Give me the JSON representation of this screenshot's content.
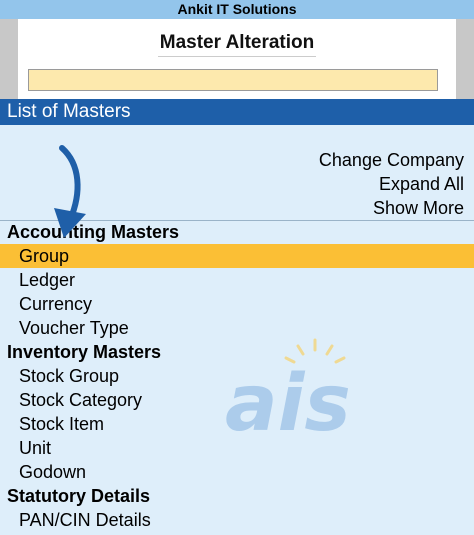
{
  "window": {
    "title": "Ankit IT Solutions"
  },
  "panel": {
    "title": "Master Alteration",
    "search_value": ""
  },
  "list": {
    "header": "List of Masters",
    "actions": [
      "Change Company",
      "Expand All",
      "Show More"
    ],
    "sections": [
      {
        "label": "Accounting Masters",
        "items": [
          "Group",
          "Ledger",
          "Currency",
          "Voucher Type"
        ]
      },
      {
        "label": "Inventory Masters",
        "items": [
          "Stock Group",
          "Stock Category",
          "Stock Item",
          "Unit",
          "Godown"
        ]
      },
      {
        "label": "Statutory Details",
        "items": [
          "PAN/CIN Details"
        ]
      }
    ],
    "selected_item": "Group"
  },
  "watermark": {
    "text": "ais"
  },
  "colors": {
    "title_bar": "#93c5eb",
    "list_header": "#1e5fa9",
    "selection": "#fbbf35",
    "search_field": "#fde9ad",
    "background": "#deeefa",
    "arrow": "#1f5fa8"
  },
  "icons": {
    "annotation": "down-arrow-icon",
    "watermark": "ais-logo-icon"
  }
}
